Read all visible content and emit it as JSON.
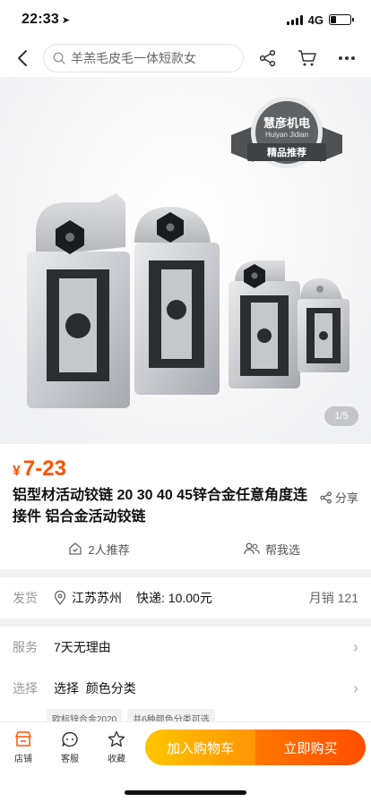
{
  "status_bar": {
    "time": "22:33",
    "network": "4G",
    "battery_level": 0.3
  },
  "nav": {
    "search_placeholder": "羊羔毛皮毛一体短款女"
  },
  "gallery": {
    "badge_title": "慧彦机电",
    "badge_subtitle": "Huiyan Jidian",
    "badge_ribbon": "精品推荐",
    "page_indicator": "1/5"
  },
  "product": {
    "currency": "¥",
    "price": "7-23",
    "title": "铝型材活动铰链 20 30 40 45锌合金任意角度连接件 铝合金活动铰链",
    "share_label": "分享",
    "recommend_count": "2人推荐",
    "help_choose": "帮我选"
  },
  "shipping": {
    "label": "发货",
    "location": "江苏苏州",
    "express": "快递: 10.00元",
    "monthly_sales": "月销 121"
  },
  "service": {
    "label": "服务",
    "value": "7天无理由"
  },
  "choose": {
    "label": "选择",
    "value": "选择  颜色分类",
    "tags": [
      "欧标锌合金2020",
      "共6种颜色分类可选"
    ]
  },
  "bottom_bar": {
    "store": "店铺",
    "customer_service": "客服",
    "favorite": "收藏",
    "add_to_cart": "加入购物车",
    "buy_now": "立即购买"
  },
  "colors": {
    "accent": "#ff5000",
    "cart_button": "#ff9402",
    "buy_button": "#ff4e00"
  }
}
